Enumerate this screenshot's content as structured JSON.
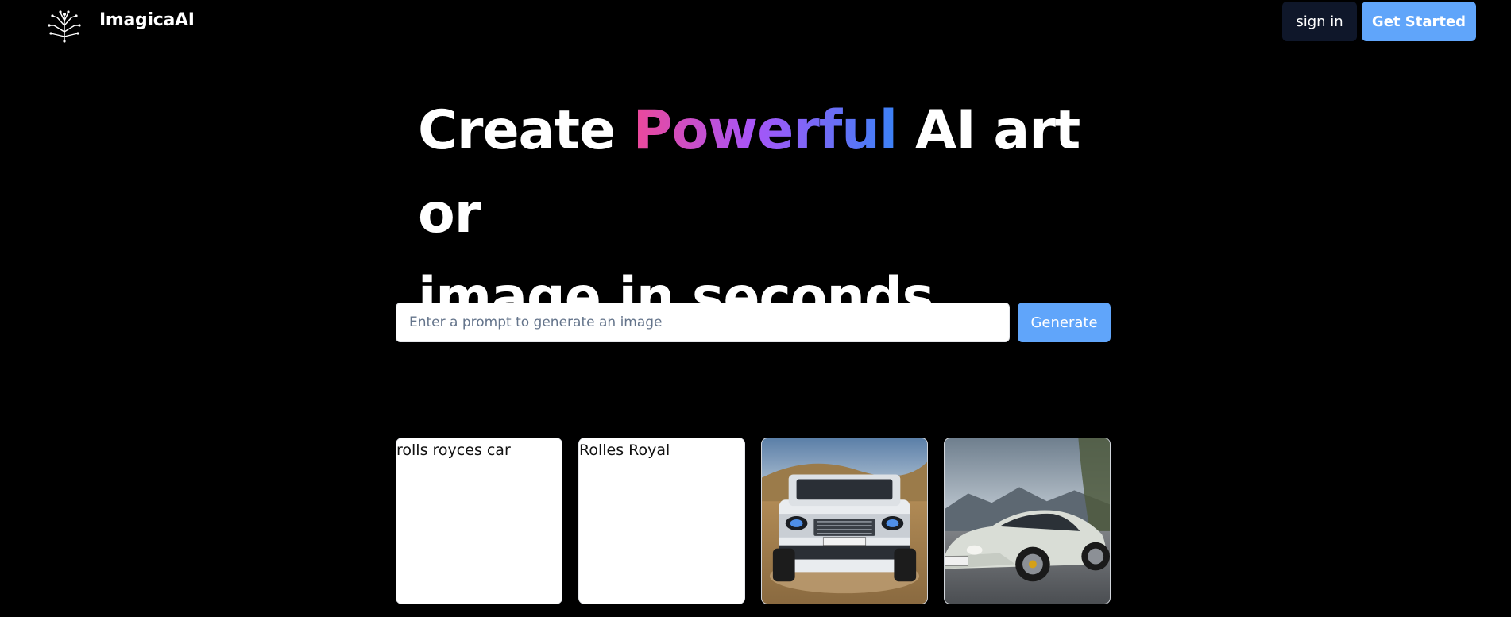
{
  "header": {
    "brand": "ImagicaAI",
    "logo_icon": "tree-circuit-icon",
    "sign_in_label": "sign in",
    "get_started_label": "Get Started"
  },
  "hero": {
    "part1": "Create ",
    "highlight": "Powerful",
    "part2": " AI art or",
    "line2": "image in seconds"
  },
  "prompt": {
    "value": "",
    "placeholder": "Enter a prompt to generate an image",
    "generate_label": "Generate"
  },
  "gallery": [
    {
      "type": "text",
      "text": "rolls royces car"
    },
    {
      "type": "text",
      "text": "Rolles Royal"
    },
    {
      "type": "image",
      "subject": "white off-road SUV on dusty desert road"
    },
    {
      "type": "image",
      "subject": "white sports coupe in front of mountains"
    }
  ],
  "colors": {
    "background": "#000000",
    "accent": "#60a5fa",
    "sign_in_bg": "#0f172a",
    "gradient": [
      "#ec4899",
      "#a855f7",
      "#3b82f6"
    ]
  }
}
